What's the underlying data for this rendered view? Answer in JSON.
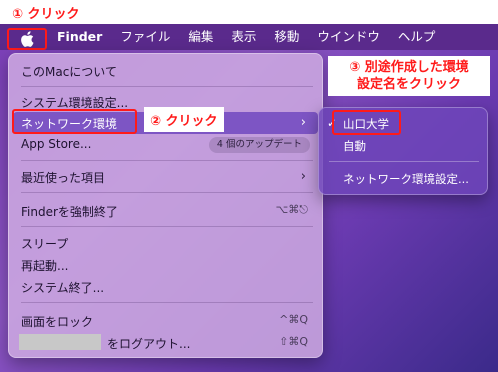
{
  "annotations": {
    "step1": "① クリック",
    "step2": "② クリック",
    "step3_line1": "③ 別途作成した環境",
    "step3_line2": "設定名をクリック"
  },
  "menubar": {
    "app": "Finder",
    "items": [
      "ファイル",
      "編集",
      "表示",
      "移動",
      "ウインドウ",
      "ヘルプ"
    ]
  },
  "apple_menu": {
    "about": "このMacについて",
    "system_prefs": "システム環境設定...",
    "network": "ネットワーク環境",
    "app_store": "App Store...",
    "app_store_badge": "4 個のアップデート",
    "recent": "最近使った項目",
    "force_quit": "Finderを強制終了",
    "force_quit_shortcut": "⌥⌘⎋",
    "sleep": "スリープ",
    "restart": "再起動...",
    "shutdown": "システム終了...",
    "lock": "画面をロック",
    "lock_shortcut": "^⌘Q",
    "logout": "をログアウト...",
    "logout_shortcut": "⇧⌘Q"
  },
  "network_submenu": {
    "checkmark": "✓",
    "items": [
      "山口大学",
      "自動"
    ],
    "prefs": "ネットワーク環境設定..."
  }
}
